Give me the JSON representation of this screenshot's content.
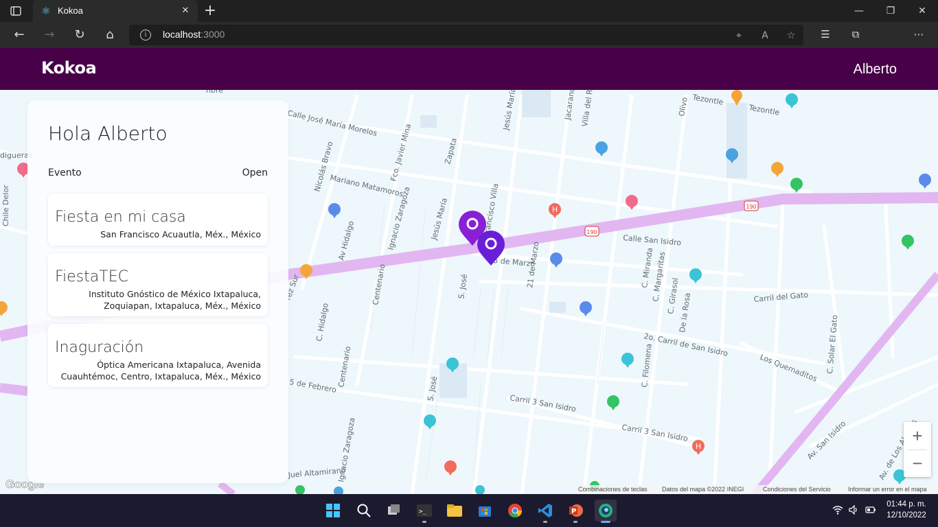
{
  "browser": {
    "tab_title": "Kokoa",
    "url_host": "localhost",
    "url_port": ":3000"
  },
  "app": {
    "brand": "Kokoa",
    "user": "Alberto",
    "primary_color": "#480049"
  },
  "panel": {
    "greeting": "Hola Alberto",
    "col_left": "Evento",
    "col_right": "Open",
    "events": [
      {
        "title": "Fiesta en mi casa",
        "address_lines": [
          "San Francisco Acuautla, Méx., México"
        ]
      },
      {
        "title": "FiestaTEC",
        "address_lines": [
          "Instituto Gnóstico de México Ixtapaluca,",
          "Zoquiapan, Ixtapaluca, Méx., México"
        ]
      },
      {
        "title": "Inaguración",
        "address_lines": [
          "Óptica Americana Ixtapaluca, Avenida",
          "Cuauhtémoc, Centro, Ixtapaluca, Méx., México"
        ]
      }
    ]
  },
  "map": {
    "street_labels": [
      "Calle José María Morelos",
      "Mariano Matamoros",
      "Nicolás Bravo",
      "Fco. Javier Mina",
      "Zapata",
      "Jesús María",
      "Francisco Villa",
      "Av Hidalgo",
      "Ignacio Zaragoza",
      "Jesús María",
      "Tezontle",
      "Tezontle",
      "Olivo",
      "Jacaranda",
      "Villa del Rosal",
      "Calle San Isidro",
      "5 de Marzo",
      "21 de Marzo",
      "S. José",
      "Centenario",
      "C. Hidalgo",
      "C. Miranda",
      "C. Margaritas",
      "C. Girasol",
      "De la Rosa",
      "Carril del Gato",
      "2o. Carril de San Isidro",
      "Los Quemaditos",
      "C. Solar El Gato",
      "C. Filomena",
      "Carril 3 San Isidro",
      "Carril 3 San Isidro",
      "5 de Febrero",
      "Centenario",
      "S. José",
      "Ignacio Zaragoza",
      "Av. San Isidro",
      "Av. de Los Alamos",
      "Juel Altamirano",
      "nbre",
      "digueras",
      "Chile Delor",
      "rez Sur"
    ],
    "highway_badge": "190",
    "zoom_in": "+",
    "zoom_out": "−",
    "attribution": [
      "Combinaciones de teclas",
      "Datos del mapa ©2022 INEGI",
      "Condiciones del Servicio",
      "Informar un error en el mapa"
    ],
    "google_logo": "Google"
  },
  "taskbar": {
    "time": "01:44 p. m.",
    "date": "12/10/2022"
  }
}
